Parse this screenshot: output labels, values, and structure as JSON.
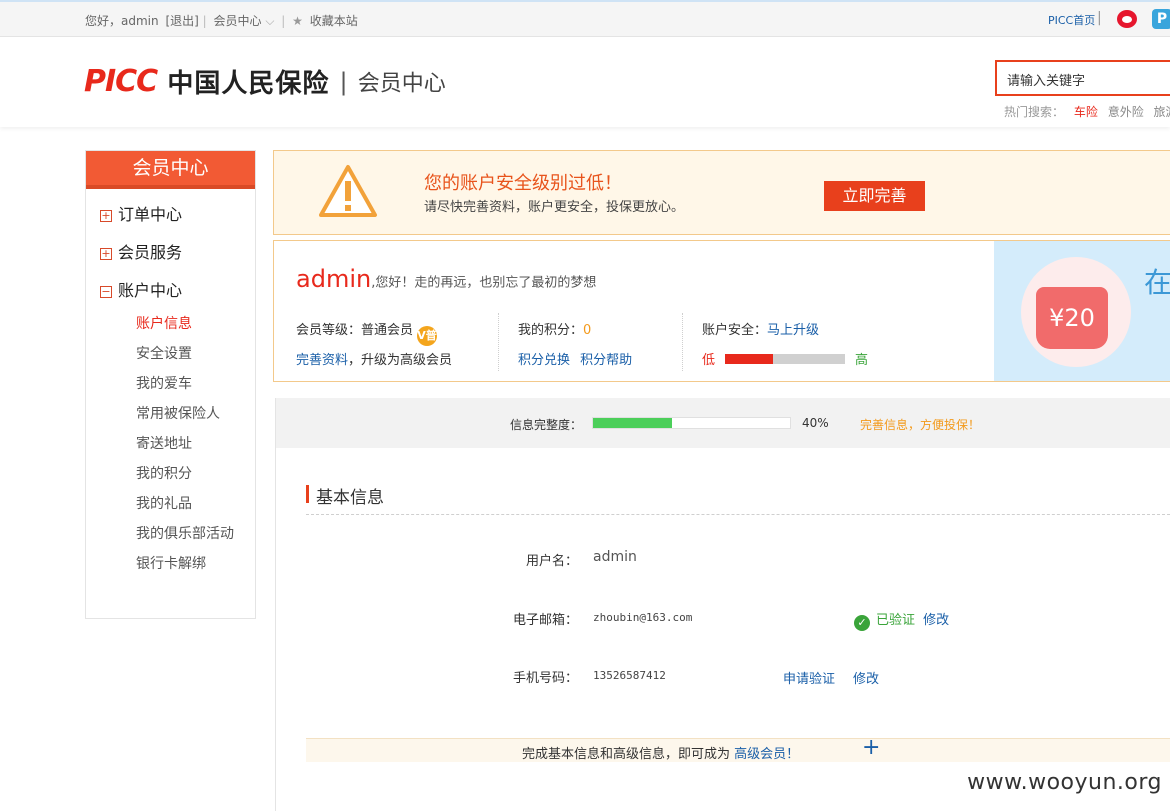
{
  "topbar": {
    "greeting": "您好，admin",
    "logout": "[退出]",
    "member_center": "会员中心",
    "favorite": "收藏本站",
    "picc_home": "PICC首页"
  },
  "header": {
    "logo_text": "PICC",
    "logo_cn": "中国人民保险",
    "subtitle": "会员中心",
    "search_placeholder": "请输入关键字",
    "hot_label": "热门搜索：",
    "hot_items": [
      "车险",
      "意外险",
      "旅游"
    ]
  },
  "sidebar": {
    "title": "会员中心",
    "categories": [
      {
        "label": "订单中心",
        "expanded": false
      },
      {
        "label": "会员服务",
        "expanded": false
      },
      {
        "label": "账户中心",
        "expanded": true
      }
    ],
    "items": [
      "账户信息",
      "安全设置",
      "我的爱车",
      "常用被保险人",
      "寄送地址",
      "我的积分",
      "我的礼品",
      "我的俱乐部活动",
      "银行卡解绑"
    ]
  },
  "warning": {
    "title": "您的账户安全级别过低！",
    "desc": "请尽快完善资料，账户更安全，投保更放心。",
    "button": "立即完善"
  },
  "profile": {
    "username": "admin",
    "greeting": ",您好！走的再远，也别忘了最初的梦想",
    "level_label": "会员等级：普通会员",
    "level_badge": "V普",
    "complete_link": "完善资料",
    "upgrade_text": "，升级为高级会员",
    "points_label": "我的积分：",
    "points_value": "0",
    "points_exchange": "积分兑换",
    "points_help": "积分帮助",
    "security_label": "账户安全：",
    "security_upgrade": "马上升级",
    "low": "低",
    "high": "高",
    "security_level": 0.4
  },
  "promo": {
    "coupon": "¥20",
    "text": "在"
  },
  "completeness": {
    "label": "信息完整度：",
    "percent_text": "40%",
    "percent": 0.4,
    "tip": "完善信息，方便投保！"
  },
  "basic": {
    "title": "基本信息",
    "username_label": "用户名：",
    "username_value": "admin",
    "email_label": "电子邮箱：",
    "email_value": "zhoubin@163.com",
    "email_verified": "已验证",
    "email_edit": "修改",
    "phone_label": "手机号码：",
    "phone_value": "13526587412",
    "phone_verify": "申请验证",
    "phone_edit": "修改"
  },
  "footer": {
    "text": "完成基本信息和高级信息，即可成为",
    "link": "高级会员！",
    "plus": "+"
  },
  "watermark": "www.wooyun.org",
  "colors": {
    "accent": "#e8401c",
    "link": "#1a5fa8",
    "success": "#3aa43a",
    "progress": "#4ccf5a"
  }
}
